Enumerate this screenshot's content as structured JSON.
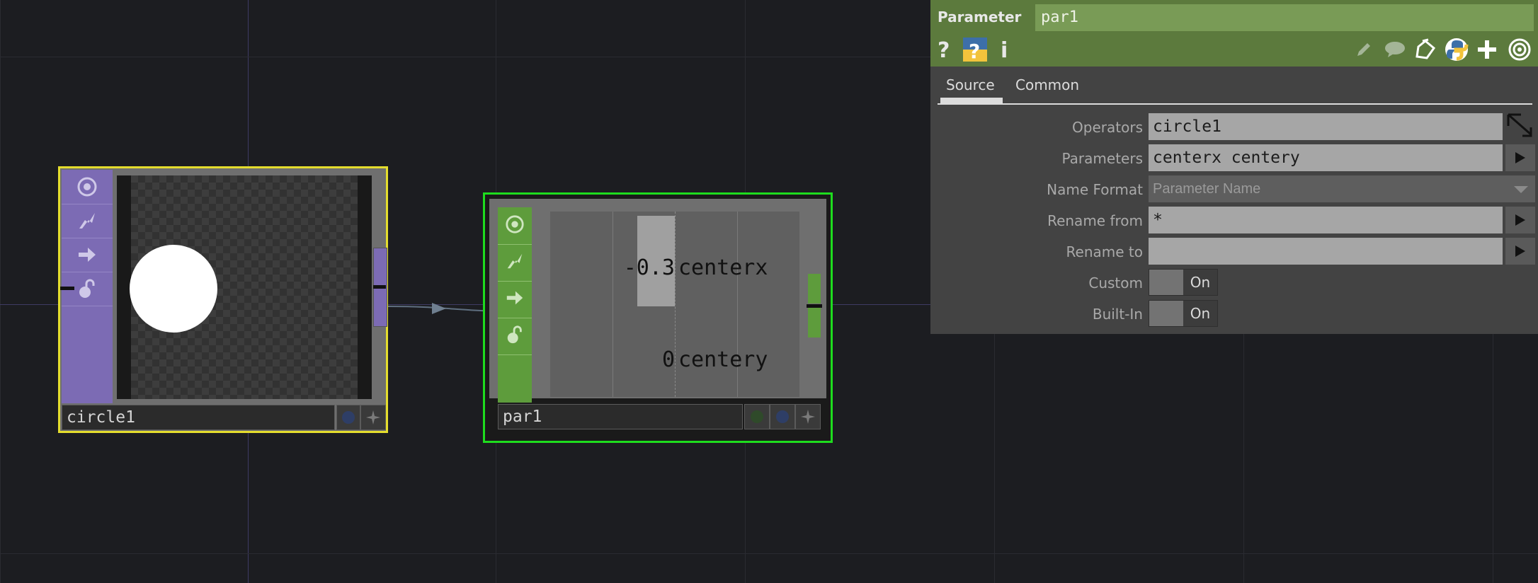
{
  "nodes": {
    "circle": {
      "name": "circle1"
    },
    "par": {
      "name": "par1",
      "channels": [
        {
          "value": "-0.3",
          "name": "centerx"
        },
        {
          "value": "0",
          "name": "centery"
        }
      ]
    }
  },
  "panel": {
    "op_type": "Parameter",
    "op_name": "par1",
    "header_icons": [
      "help-icon",
      "python-help-icon",
      "info-icon",
      "pencil-icon",
      "comment-icon",
      "clone-icon",
      "python-icon",
      "add-icon",
      "viewer-icon"
    ],
    "tabs": [
      {
        "label": "Source",
        "active": true
      },
      {
        "label": "Common",
        "active": false
      }
    ],
    "params": {
      "operators": {
        "label": "Operators",
        "value": "circle1"
      },
      "parameters": {
        "label": "Parameters",
        "value": "centerx centery"
      },
      "name_format": {
        "label": "Name Format",
        "value": "Parameter Name"
      },
      "rename_from": {
        "label": "Rename from",
        "value": "*"
      },
      "rename_to": {
        "label": "Rename to",
        "value": ""
      },
      "custom": {
        "label": "Custom",
        "value": "On"
      },
      "builtin": {
        "label": "Built-In",
        "value": "On"
      }
    }
  },
  "colors": {
    "background": "#1c1d21",
    "top_accent": "#7c6bb4",
    "chop_accent": "#5e9c3c",
    "panel_header": "#5c7a3d",
    "selected_border": "#e4dd2d",
    "current_border": "#1edc1e"
  }
}
